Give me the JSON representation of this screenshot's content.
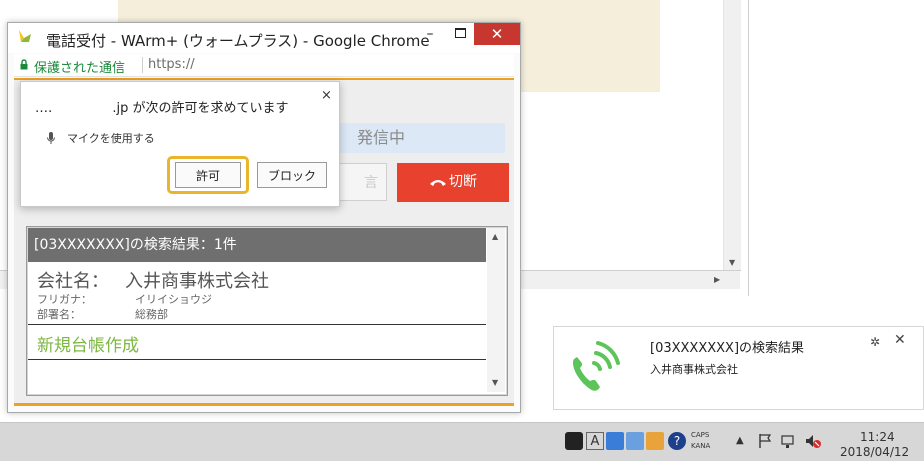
{
  "chrome_window": {
    "title": "電話受付 - WArm+ (ウォームプラス) - Google Chrome",
    "min_glyph": "–",
    "close_glyph": "✕",
    "secure_label": "保護された通信",
    "url": "https://"
  },
  "permission_popup": {
    "domain": "…․",
    "message": ".jp が次の許可を求めています",
    "permission": "マイクを使用する",
    "allow_label": "許可",
    "block_label": "ブロック",
    "close_glyph": "×"
  },
  "call_panel": {
    "status": "発信中",
    "ghost_button_label": "言",
    "hangup_label": "切断"
  },
  "search_results": {
    "header": "[03XXXXXXX]の検索結果：1件",
    "company_label": "会社名：",
    "company_value": "入井商事株式会社",
    "kana_label": "フリガナ：",
    "kana_value": "イリイショウジ",
    "dept_label": "部署名：",
    "dept_value": "総務部",
    "new_ledger": "新規台帳作成"
  },
  "notification": {
    "title": "[03XXXXXXX]の検索結果",
    "subtitle": "入井商事株式会社",
    "gear_glyph": "✲",
    "close_glyph": "✕"
  },
  "taskbar": {
    "caps": "CAPS",
    "kana": "KANA",
    "ime_glyph": "A",
    "time": "11:24",
    "date": "2018/04/12"
  },
  "colors": {
    "accent_orange": "#f0a020",
    "hangup_red": "#e8412e",
    "secure_green": "#1a8a3a",
    "new_ledger_green": "#7db840",
    "phone_green": "#5dc45a",
    "allow_highlight": "#eab52a"
  }
}
